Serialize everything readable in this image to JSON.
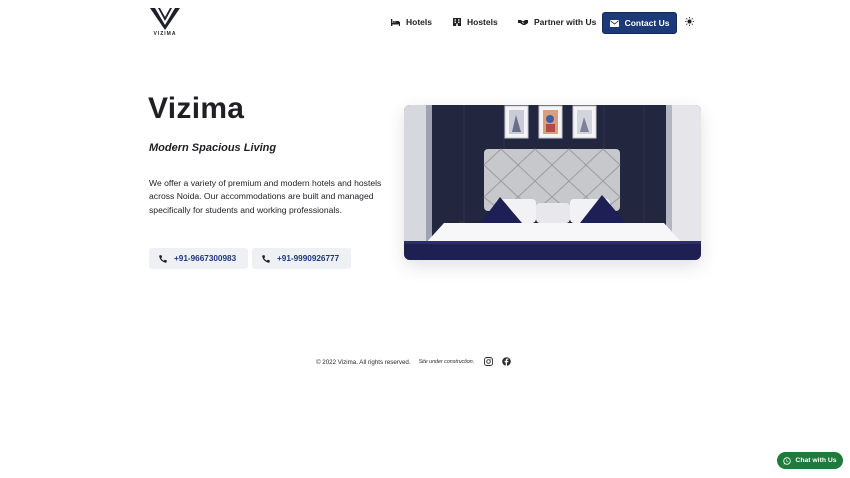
{
  "brand": {
    "logo_text": "VIZIMA"
  },
  "nav": {
    "hotels": "Hotels",
    "hostels": "Hostels",
    "partner": "Partner with Us",
    "contact": "Contact Us"
  },
  "hero": {
    "title": "Vizima",
    "subtitle": "Modern Spacious Living",
    "description": "We offer a variety of premium and modern hotels and hostels across Noida. Our accommodations are built and managed specifically for students and working professionals.",
    "phones": [
      "+91-9667300983",
      "+91-9990926777"
    ]
  },
  "footer": {
    "copyright": "© 2022 Vizima. All rights reserved.",
    "construction": "Site under construction."
  },
  "chat": {
    "label": "Chat with Us"
  },
  "colors": {
    "primary": "#1c3a78",
    "chat": "#1e7b3b"
  },
  "icons": {
    "nav_hotels": "bed-icon",
    "nav_hostels": "building-icon",
    "nav_partner": "handshake-icon",
    "nav_contact": "mail-icon",
    "theme": "sun-icon",
    "phone": "phone-icon",
    "social": [
      "instagram-icon",
      "facebook-icon"
    ],
    "chat": "whatsapp-icon"
  }
}
